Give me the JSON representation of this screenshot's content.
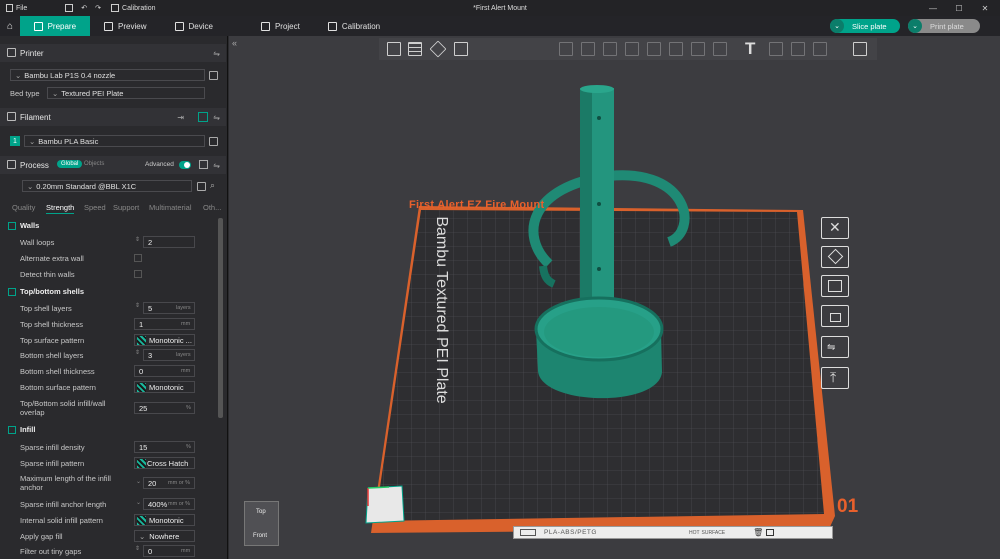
{
  "titlebar": {
    "file_label": "File",
    "calibration_label": "Calibration",
    "document_title": "*First Alert Mount"
  },
  "tabs": [
    {
      "label": "Prepare",
      "icon": "cube-icon"
    },
    {
      "label": "Preview",
      "icon": "layers-icon"
    },
    {
      "label": "Device",
      "icon": "printer-icon"
    },
    {
      "label": "Project",
      "icon": "project-icon"
    },
    {
      "label": "Calibration",
      "icon": "calibration-icon"
    }
  ],
  "actions": {
    "slice_plate": "Slice plate",
    "print_plate": "Print plate"
  },
  "printer": {
    "section_title": "Printer",
    "printer_name": "Bambu Lab P1S 0.4 nozzle",
    "bed_type_label": "Bed type",
    "bed_type_value": "Textured PEI Plate"
  },
  "filament": {
    "section_title": "Filament",
    "slot_number": "1",
    "name": "Bambu PLA Basic",
    "color": "#00a38a"
  },
  "process": {
    "section_title": "Process",
    "global_label": "Global",
    "objects_label": "Objects",
    "advanced_label": "Advanced",
    "preset": "0.20mm Standard @BBL X1C",
    "subtabs": [
      "Quality",
      "Strength",
      "Speed",
      "Support",
      "Multimaterial",
      "Oth..."
    ],
    "active_subtab": "Strength"
  },
  "settings": {
    "walls": {
      "title": "Walls",
      "wall_loops_label": "Wall loops",
      "wall_loops": "2",
      "alternate_extra_wall_label": "Alternate extra wall",
      "detect_thin_walls_label": "Detect thin walls"
    },
    "shells": {
      "title": "Top/bottom shells",
      "top_layers_label": "Top shell layers",
      "top_layers": "5",
      "layers_unit": "layers",
      "top_thickness_label": "Top shell thickness",
      "top_thickness": "1",
      "mm_unit": "mm",
      "top_pattern_label": "Top surface pattern",
      "top_pattern": "Monotonic ...",
      "bottom_layers_label": "Bottom shell layers",
      "bottom_layers": "3",
      "bottom_thickness_label": "Bottom shell thickness",
      "bottom_thickness": "0",
      "bottom_pattern_label": "Bottom surface pattern",
      "bottom_pattern": "Monotonic",
      "overlap_label_1": "Top/Bottom solid infill/wall",
      "overlap_label_2": "overlap",
      "overlap": "25",
      "percent_unit": "%"
    },
    "infill": {
      "title": "Infill",
      "density_label": "Sparse infill density",
      "density": "15",
      "pattern_label": "Sparse infill pattern",
      "pattern": "Cross Hatch",
      "max_anchor_label_1": "Maximum length of the infill",
      "max_anchor_label_2": "anchor",
      "max_anchor": "20",
      "mm_or_percent": "mm or %",
      "anchor_label": "Sparse infill anchor length",
      "anchor": "400%",
      "internal_pattern_label": "Internal solid infill pattern",
      "internal_pattern": "Monotonic",
      "gap_fill_label": "Apply gap fill",
      "gap_fill": "Nowhere",
      "filter_gaps_label": "Filter out tiny gaps",
      "filter_gaps": "0"
    }
  },
  "viewport": {
    "plate_label": "First Alert EZ Fire Mount",
    "plate_text": "Bambu Textured PEI Plate",
    "plate_number": "01",
    "filament_type": "PLA-ABS/PETG",
    "surface_label_1": "HOT",
    "surface_label_2": "SURFACE",
    "view_top": "Top",
    "view_front": "Front",
    "model_color": "#1f8a75",
    "plate_accent": "#e8602c"
  }
}
